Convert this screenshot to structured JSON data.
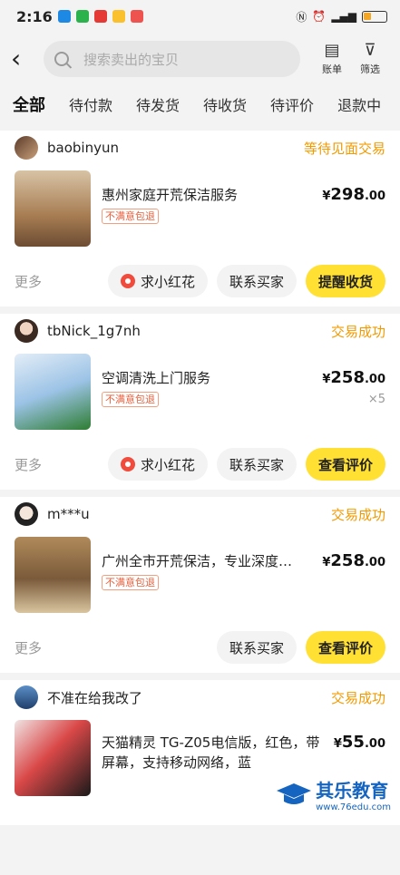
{
  "status_bar": {
    "time": "2:16"
  },
  "search": {
    "placeholder": "搜索卖出的宝贝"
  },
  "toolbar": {
    "bill_label": "账单",
    "filter_label": "筛选"
  },
  "tabs": [
    {
      "label": "全部",
      "active": true
    },
    {
      "label": "待付款"
    },
    {
      "label": "待发货"
    },
    {
      "label": "待收货"
    },
    {
      "label": "待评价"
    },
    {
      "label": "退款中"
    }
  ],
  "orders": [
    {
      "buyer": "baobinyun",
      "status": "等待见面交易",
      "title": "惠州家庭开荒保洁服务",
      "badge": "不满意包退",
      "price_int": "298",
      "price_dec": ".00",
      "quantity": "",
      "more": "更多",
      "buttons": [
        "求小红花",
        "联系买家",
        "提醒收货"
      ]
    },
    {
      "buyer": "tbNick_1g7nh",
      "status": "交易成功",
      "title": "空调清洗上门服务",
      "badge": "不满意包退",
      "price_int": "258",
      "price_dec": ".00",
      "quantity": "×5",
      "more": "更多",
      "buttons": [
        "求小红花",
        "联系买家",
        "查看评价"
      ]
    },
    {
      "buyer": "m***u",
      "status": "交易成功",
      "title": "广州全市开荒保洁，专业深度…",
      "badge": "不满意包退",
      "price_int": "258",
      "price_dec": ".00",
      "quantity": "",
      "more": "更多",
      "buttons": [
        "联系买家",
        "查看评价"
      ]
    },
    {
      "buyer": "不准在给我改了",
      "status": "交易成功",
      "title": "天猫精灵 TG-Z05电信版，红色，带屏幕，支持移动网络，蓝",
      "price_int": "55",
      "price_dec": ".00"
    }
  ],
  "currency_symbol": "¥",
  "watermark": {
    "name": "其乐教育",
    "url": "www.76edu.com"
  },
  "colors": {
    "accent_yellow": "#ffe033",
    "status_orange": "#f39a00",
    "badge_red": "#e8603c"
  }
}
